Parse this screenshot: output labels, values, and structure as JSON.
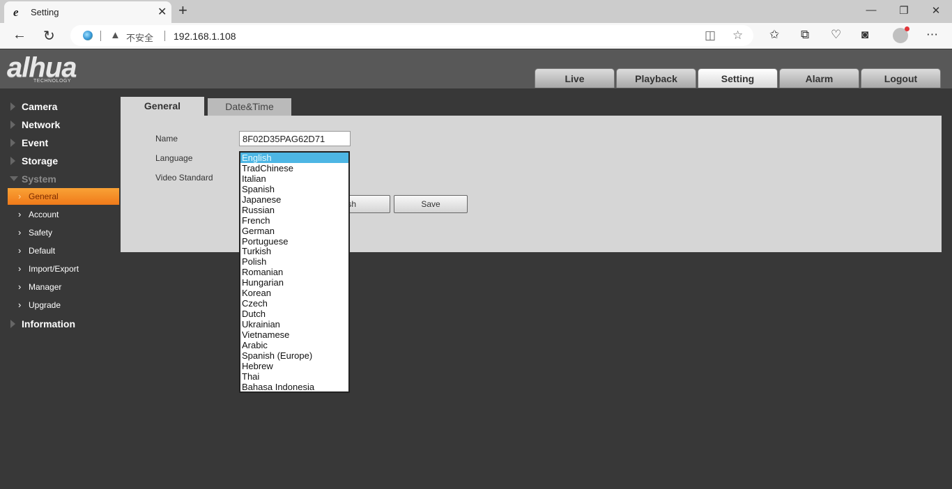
{
  "browser": {
    "tab_title": "Setting",
    "tab_favicon": "e",
    "security_label": "不安全",
    "url": "192.168.1.108",
    "icons": [
      "back-icon",
      "refresh-icon",
      "site-icon",
      "warning-icon",
      "reader-mode-icon",
      "favorite-star-icon",
      "favorites-list-icon",
      "collections-icon",
      "health-icon",
      "sidebar-edge-icon",
      "profile-avatar",
      "more-icon"
    ]
  },
  "header": {
    "logo": "alhua",
    "logo_sub": "TECHNOLOGY",
    "tabs": [
      {
        "label": "Live",
        "active": false
      },
      {
        "label": "Playback",
        "active": false
      },
      {
        "label": "Setting",
        "active": true
      },
      {
        "label": "Alarm",
        "active": false
      },
      {
        "label": "Logout",
        "active": false
      }
    ]
  },
  "sidebar": {
    "groups_before": [
      {
        "label": "Camera"
      },
      {
        "label": "Network"
      },
      {
        "label": "Event"
      },
      {
        "label": "Storage"
      }
    ],
    "expanded_group": {
      "label": "System"
    },
    "sub_items": [
      {
        "label": "General",
        "active": true
      },
      {
        "label": "Account",
        "active": false
      },
      {
        "label": "Safety",
        "active": false
      },
      {
        "label": "Default",
        "active": false
      },
      {
        "label": "Import/Export",
        "active": false
      },
      {
        "label": "Manager",
        "active": false
      },
      {
        "label": "Upgrade",
        "active": false
      }
    ],
    "groups_after": [
      {
        "label": "Information"
      }
    ]
  },
  "content": {
    "tabs": [
      {
        "label": "General",
        "active": true
      },
      {
        "label": "Date&Time",
        "active": false
      }
    ],
    "form": {
      "name_label": "Name",
      "name_value": "8F02D35PAG62D71",
      "language_label": "Language",
      "video_standard_label": "Video Standard",
      "refresh_label": "Refresh",
      "save_label": "Save"
    },
    "language_dropdown": {
      "selected": "English",
      "options": [
        "English",
        "TradChinese",
        "Italian",
        "Spanish",
        "Japanese",
        "Russian",
        "French",
        "German",
        "Portuguese",
        "Turkish",
        "Polish",
        "Romanian",
        "Hungarian",
        "Korean",
        "Czech",
        "Dutch",
        "Ukrainian",
        "Vietnamese",
        "Arabic",
        "Spanish (Europe)",
        "Hebrew",
        "Thai",
        "Bahasa Indonesia"
      ]
    }
  }
}
